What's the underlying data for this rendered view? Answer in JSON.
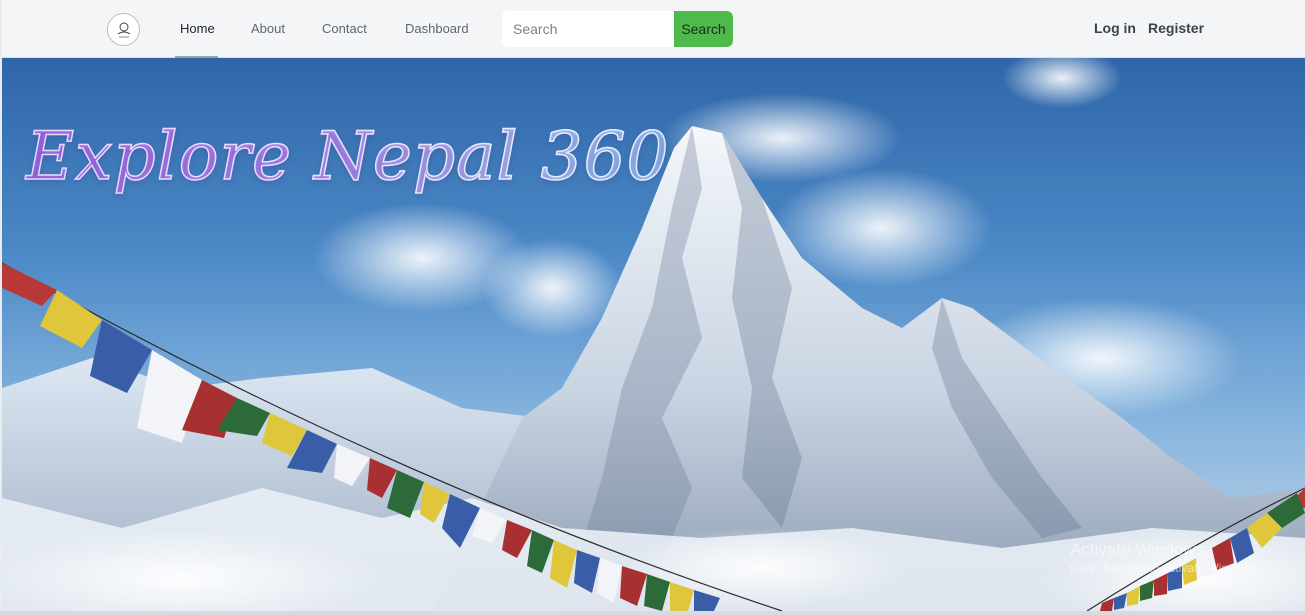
{
  "nav": {
    "links": [
      {
        "label": "Home",
        "active": true
      },
      {
        "label": "About",
        "active": false
      },
      {
        "label": "Contact",
        "active": false
      },
      {
        "label": "Dashboard",
        "active": false
      }
    ],
    "search": {
      "placeholder": "Search",
      "button_label": "Search"
    },
    "auth": {
      "login_label": "Log in",
      "register_label": "Register"
    }
  },
  "hero": {
    "title": "Explore Nepal 360"
  },
  "watermark": {
    "line1": "Activate Windows",
    "line2": "Go to Settings to activate Windows."
  },
  "colors": {
    "search_button": "#4fba4c",
    "navbar_bg": "#f4f5f7",
    "title_gradient_start": "#a46cf0",
    "title_gradient_end": "#8fc3f5"
  }
}
